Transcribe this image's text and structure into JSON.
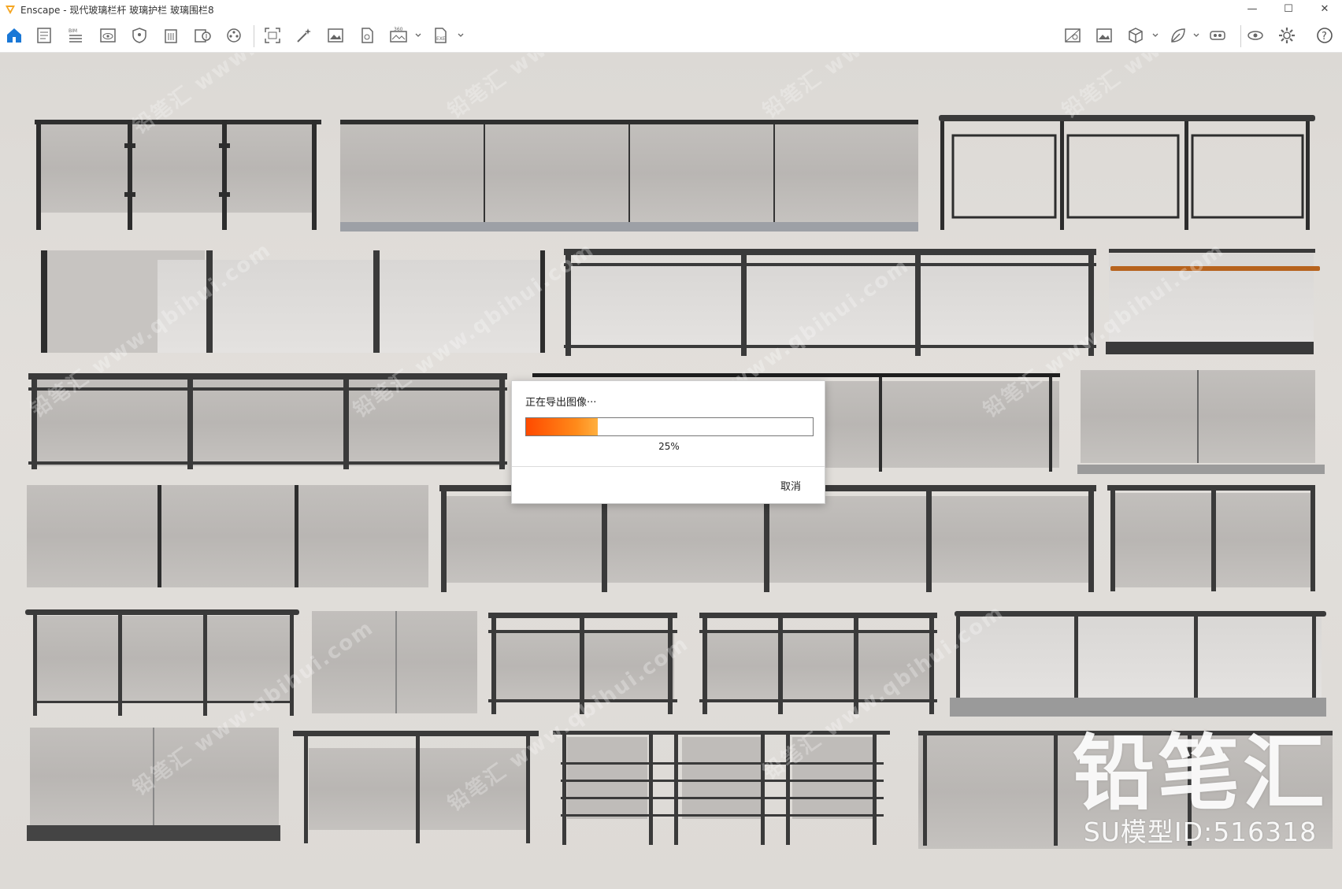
{
  "window": {
    "title": "Enscape - 现代玻璃栏杆 玻璃护栏 玻璃围栏8",
    "controls": {
      "minimize": "—",
      "maximize": "☐",
      "close": "✕"
    }
  },
  "toolbar": {
    "bim_label": "BIM",
    "pano_label": "360",
    "exe_label": "EXE",
    "accent_color": "#1a78d6"
  },
  "dialog": {
    "message": "正在导出图像···",
    "progress_percent": 25,
    "progress_label": "25%",
    "cancel_label": "取消"
  },
  "branding": {
    "logo_text": "铅笔汇",
    "model_id_text": "SU模型ID:516318"
  },
  "watermarks": {
    "text": "铅笔汇 www.qbihui.com"
  }
}
